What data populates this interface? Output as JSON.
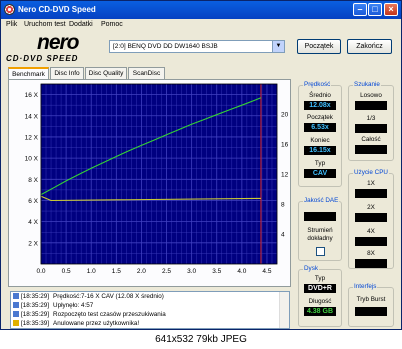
{
  "window": {
    "title": "Nero CD-DVD Speed"
  },
  "menu": [
    "Plik",
    "Uruchom test",
    "Dodatki",
    "Pomoc"
  ],
  "logo": {
    "brand": "nero",
    "product": "CD·DVD SPEED"
  },
  "drive": {
    "selected": "[2:0]  BENQ DVD DD DW1640 BSJB"
  },
  "buttons": {
    "start": "Początek",
    "stop": "Zakończ"
  },
  "tabs": [
    "Benchmark",
    "Disc Info",
    "Disc Quality",
    "ScanDisc"
  ],
  "chart_data": {
    "type": "line",
    "x_ticks": [
      "0.0",
      "0.5",
      "1.0",
      "1.5",
      "2.0",
      "2.5",
      "3.0",
      "3.5",
      "4.0",
      "4.5"
    ],
    "y_left_ticks": [
      "16 X",
      "14 X",
      "12 X",
      "10 X",
      "8 X",
      "6 X",
      "4 X",
      "2 X"
    ],
    "y_right_ticks": [
      "20",
      "16",
      "12",
      "8",
      "4"
    ],
    "xlim": [
      0,
      4.7
    ],
    "ylim": [
      0,
      17
    ],
    "disc_end": 4.38,
    "colors": {
      "background": "#000080",
      "grid": "#4040c0",
      "speed": "#35d335",
      "aux": "#cccc33",
      "end_marker": "#d02020"
    },
    "series": [
      {
        "values_x": [
          0,
          0.25,
          0.5,
          0.75,
          1,
          1.25,
          1.5,
          1.75,
          2,
          2.25,
          2.5,
          2.75,
          3,
          3.25,
          3.5,
          3.75,
          4,
          4.25,
          4.38
        ],
        "values_y": [
          6.55,
          7.2,
          7.85,
          8.45,
          9.05,
          9.6,
          10.15,
          10.7,
          11.2,
          11.7,
          12.2,
          12.7,
          13.2,
          13.65,
          14.1,
          14.55,
          15.0,
          15.45,
          15.7
        ]
      },
      {
        "values_x": [
          0,
          0.2,
          4.38
        ],
        "values_y": [
          6.4,
          6.0,
          6.2
        ]
      }
    ]
  },
  "log": [
    {
      "time": "[18:35:29]",
      "text": "Prędkość:7-16 X CAV (12.08 X średnio)"
    },
    {
      "time": "[18:35:29]",
      "text": "Upłynęło:  4:57"
    },
    {
      "time": "[18:35:29]",
      "text": "Rozpoczęto test czasów przeszukiwania"
    },
    {
      "time": "[18:35:39]",
      "text": "Anulowane przez użytkownika!"
    }
  ],
  "speed": {
    "group": "Prędkość",
    "avg_label": "Średnio",
    "avg": "12.08x",
    "start_label": "Początek",
    "start": "6.53x",
    "end_label": "Koniec",
    "end": "16.15x",
    "type_label": "Typ",
    "type": "CAV"
  },
  "dae": {
    "group": "Jakość DAE",
    "accurate_label": "Strumień dokładny"
  },
  "disc": {
    "group": "Dysk",
    "type_label": "Typ",
    "type": "DVD+R",
    "length_label": "Długość",
    "length": "4.38 GB"
  },
  "seek": {
    "group": "Szukanie",
    "random": "Losowo",
    "third": "1/3",
    "full": "Całość"
  },
  "cpu": {
    "group": "Użycie CPU",
    "x1": "1X",
    "x2": "2X",
    "x4": "4X",
    "x8": "8X"
  },
  "iface": {
    "group": "Interfejs",
    "burst": "Tryb Burst"
  },
  "caption": "641x532 79kb JPEG"
}
